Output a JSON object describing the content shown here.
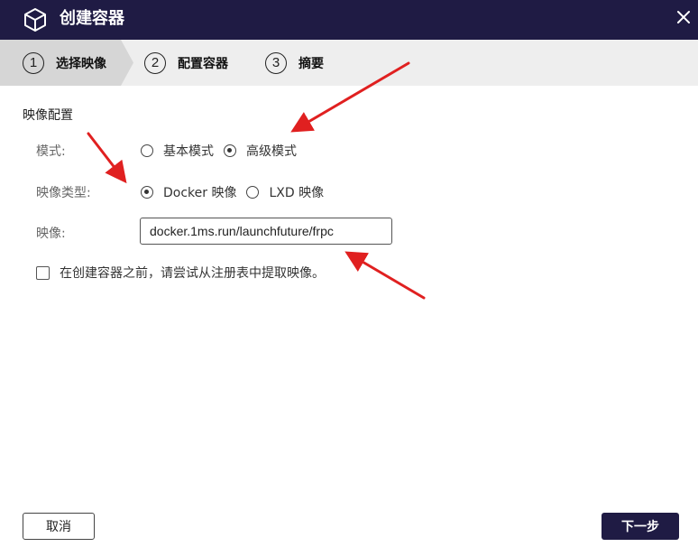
{
  "window": {
    "title": "创建容器",
    "title_icon": "cube-icon",
    "close_icon": "close-icon"
  },
  "stepper": {
    "steps": [
      {
        "number": "1",
        "label": "选择映像",
        "active": true
      },
      {
        "number": "2",
        "label": "配置容器",
        "active": false
      },
      {
        "number": "3",
        "label": "摘要",
        "active": false
      }
    ]
  },
  "form": {
    "section_title": "映像配置",
    "mode": {
      "label": "模式:",
      "options": [
        {
          "label": "基本模式",
          "checked": false
        },
        {
          "label": "高级模式",
          "checked": true
        }
      ]
    },
    "image_type": {
      "label": "映像类型:",
      "options": [
        {
          "label": "Docker 映像",
          "checked": true
        },
        {
          "label": "LXD 映像",
          "checked": false
        }
      ]
    },
    "image": {
      "label": "映像:",
      "value": "docker.1ms.run/launchfuture/frpc"
    },
    "pull_checkbox": {
      "label": "在创建容器之前，请尝试从注册表中提取映像。",
      "checked": false
    }
  },
  "footer": {
    "cancel_label": "取消",
    "next_label": "下一步"
  },
  "colors": {
    "header_bg": "#1f1b44",
    "stepper_bg": "#eeeeee",
    "active_step_bg": "#d6d6d6",
    "annotation_arrow": "#e02020"
  }
}
